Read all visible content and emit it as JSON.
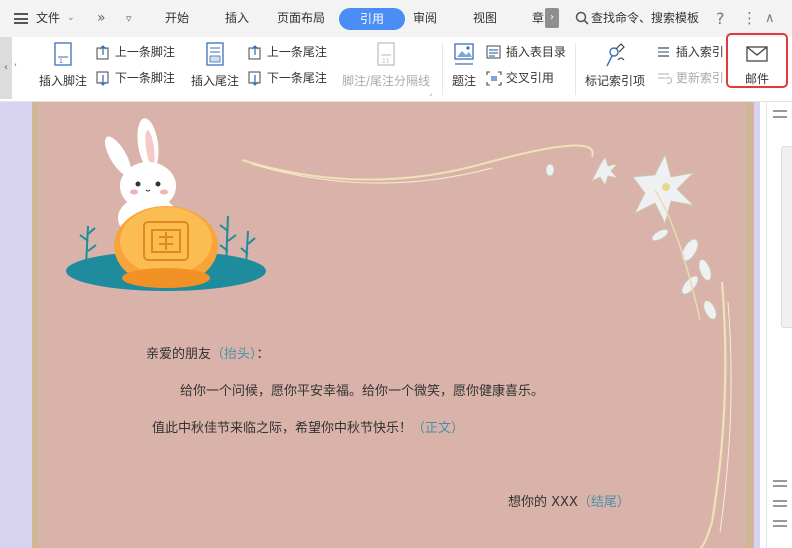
{
  "menubar": {
    "file_label": "文件",
    "more_glyph": "»",
    "tabs": [
      "开始",
      "插入",
      "页面布局",
      "引用",
      "审阅",
      "视图",
      "章"
    ],
    "active_tab": "引用",
    "search_placeholder": "查找命令、搜索模板",
    "help_glyph": "?",
    "more_menu_glyph": "⋮",
    "collapse_glyph": "∧"
  },
  "ribbon": {
    "insert_footnote": "插入脚注",
    "prev_footnote": "上一条脚注",
    "next_footnote": "下一条脚注",
    "insert_endnote": "插入尾注",
    "prev_endnote": "上一条尾注",
    "next_endnote": "下一条尾注",
    "note_separator": "脚注/尾注分隔线",
    "caption": "题注",
    "insert_table_of_figures": "插入表目录",
    "cross_reference": "交叉引用",
    "mark_index_entry": "标记索引项",
    "insert_index": "插入索引",
    "update_index": "更新索引",
    "mail": "邮件"
  },
  "document": {
    "salutation": "亲爱的朋友",
    "salutation_hint": "（抬头）",
    "salutation_colon": "：",
    "body_line1": "给你一个问候，愿你平安幸福。给你一个微笑，愿你健康喜乐。",
    "body_line2": "值此中秋佳节来临之际，希望你中秋节快乐！",
    "body_hint": "（正文）",
    "signature": "想你的 XXX",
    "signature_hint": "（结尾）"
  },
  "colors": {
    "accent": "#4a8df5",
    "page_background": "#d9b3a9",
    "workspace": "#d8d3f1",
    "highlight": "#e03a3a",
    "hint_text": "#4a8fa6"
  }
}
